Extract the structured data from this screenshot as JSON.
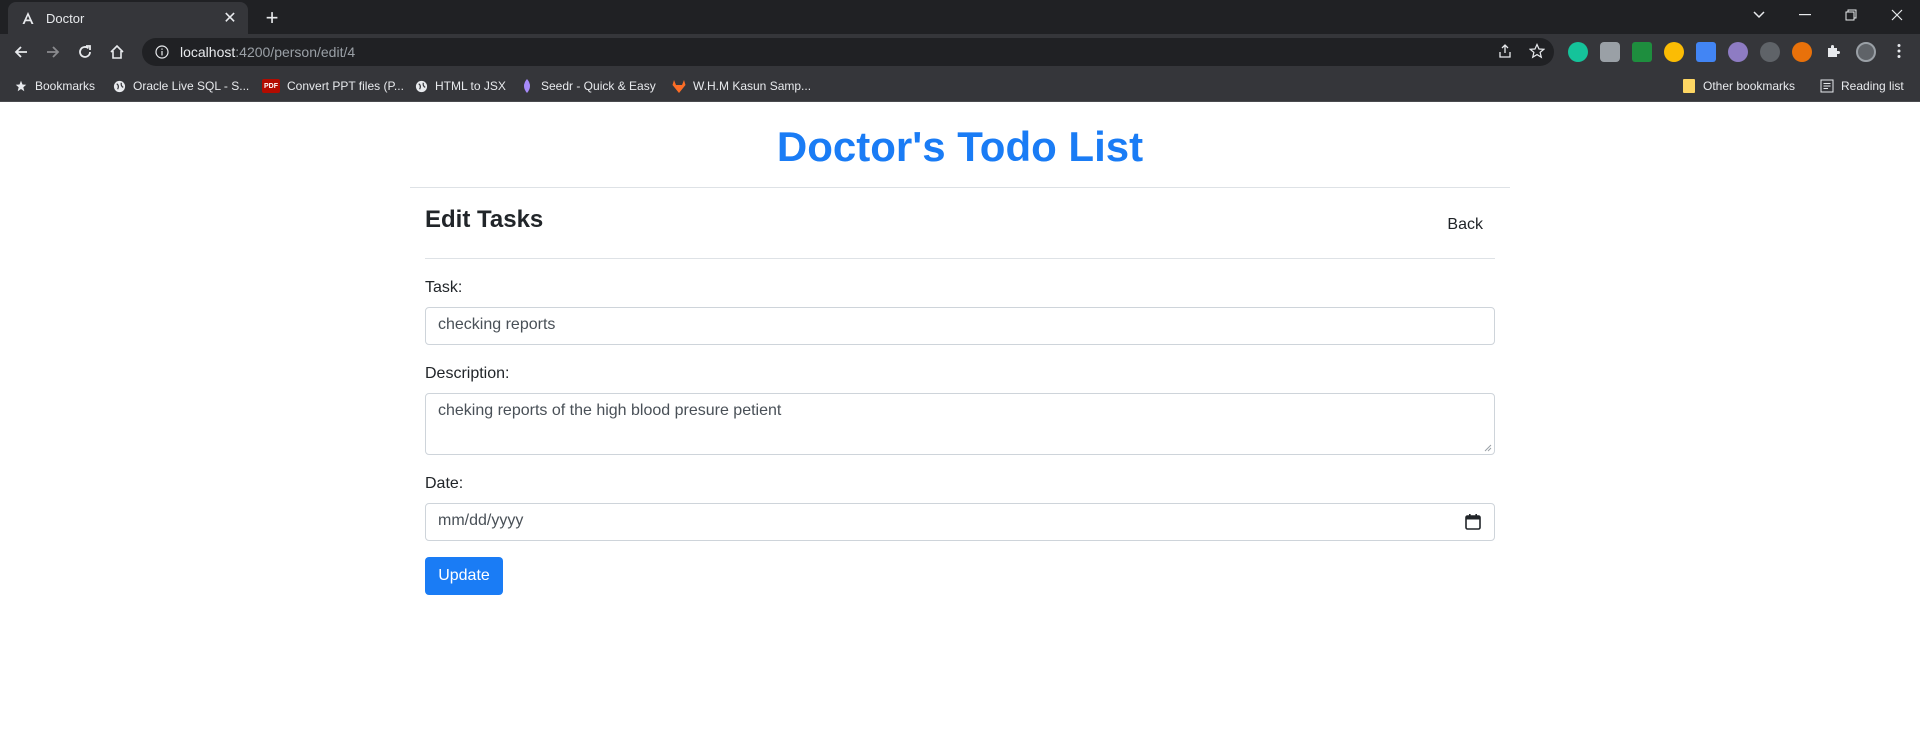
{
  "browser": {
    "tab_title": "Doctor",
    "url_host": "localhost",
    "url_path": ":4200/person/edit/4",
    "bookmarks": [
      {
        "label": "Bookmarks",
        "icon": "star-icon"
      },
      {
        "label": "Oracle Live SQL - S...",
        "icon": "globe-icon"
      },
      {
        "label": "Convert PPT files (P...",
        "icon": "pdf-icon"
      },
      {
        "label": "HTML to JSX",
        "icon": "globe-icon"
      },
      {
        "label": "Seedr - Quick & Easy",
        "icon": "seedr-icon"
      },
      {
        "label": "W.H.M Kasun Samp...",
        "icon": "gitlab-icon"
      }
    ],
    "other_bookmarks": "Other bookmarks",
    "reading_list": "Reading list",
    "pdf_badge": "PDF"
  },
  "page": {
    "site_title": "Doctor's Todo List",
    "heading": "Edit Tasks",
    "back_label": "Back",
    "task_label": "Task:",
    "task_value": "checking reports",
    "description_label": "Description:",
    "description_value": "cheking reports of the high blood presure petient",
    "date_label": "Date:",
    "date_placeholder": "mm/dd/yyyy",
    "update_label": "Update"
  },
  "colors": {
    "accent": "#1a7cf5",
    "chrome_dark": "#202124",
    "chrome_toolbar": "#35363a"
  }
}
